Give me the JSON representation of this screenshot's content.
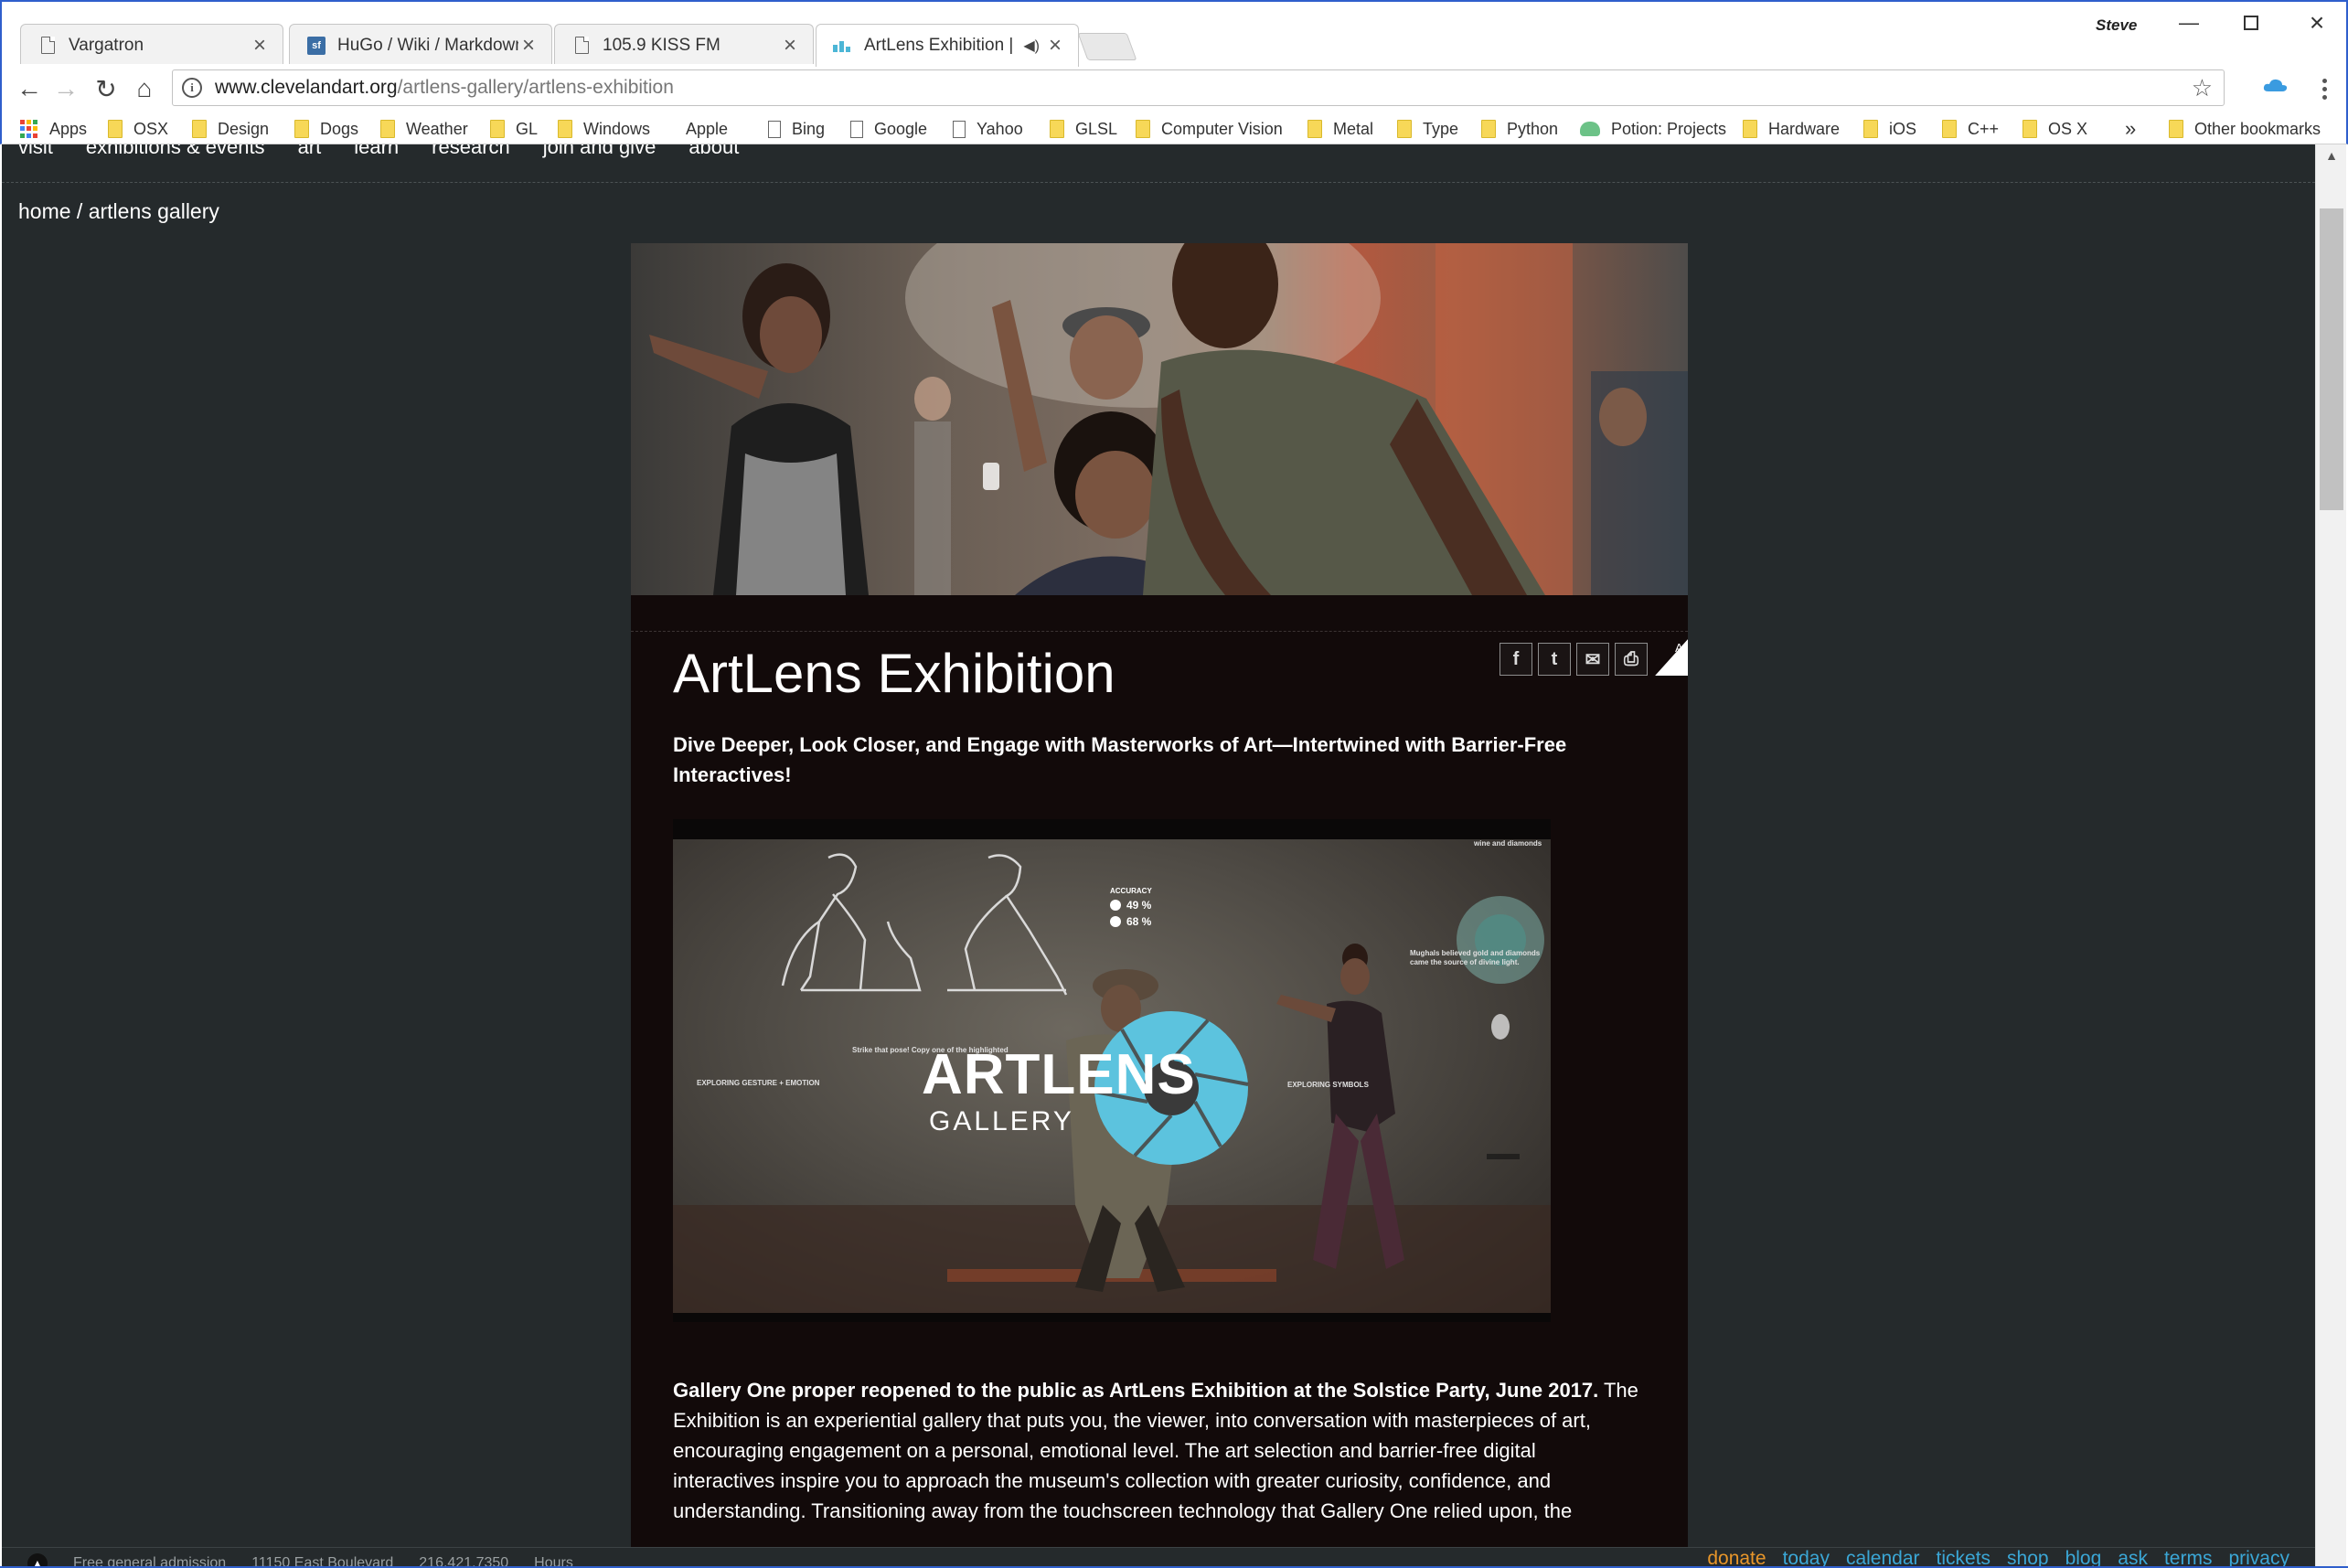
{
  "browser": {
    "tabs": [
      {
        "title": "Vargatron",
        "icon": "document-icon",
        "active": false
      },
      {
        "title": "HuGo / Wiki / Markdown",
        "icon": "sourceforge-icon",
        "active": false
      },
      {
        "title": "105.9 KISS FM",
        "icon": "document-icon",
        "active": false
      },
      {
        "title": "ArtLens Exhibition | Cl",
        "icon": "cma-icon",
        "active": true,
        "audio": true
      }
    ],
    "profile_name": "Steve",
    "url_domain": "www.clevelandart.org",
    "url_path": "/artlens-gallery/artlens-exhibition",
    "bookmarks": [
      {
        "label": "Apps",
        "icon": "apps-icon"
      },
      {
        "label": "OSX",
        "icon": "folder-icon"
      },
      {
        "label": "Design",
        "icon": "folder-icon"
      },
      {
        "label": "Dogs",
        "icon": "folder-icon"
      },
      {
        "label": "Weather",
        "icon": "folder-icon"
      },
      {
        "label": "GL",
        "icon": "folder-icon"
      },
      {
        "label": "Windows",
        "icon": "folder-icon"
      },
      {
        "label": "Apple",
        "icon": "apple-icon"
      },
      {
        "label": "Bing",
        "icon": "page-icon"
      },
      {
        "label": "Google",
        "icon": "page-icon"
      },
      {
        "label": "Yahoo",
        "icon": "page-icon"
      },
      {
        "label": "GLSL",
        "icon": "folder-icon"
      },
      {
        "label": "Computer Vision",
        "icon": "folder-icon"
      },
      {
        "label": "Metal",
        "icon": "folder-icon"
      },
      {
        "label": "Type",
        "icon": "folder-icon"
      },
      {
        "label": "Python",
        "icon": "folder-icon"
      },
      {
        "label": "Potion: Projects",
        "icon": "potion-icon"
      },
      {
        "label": "Hardware",
        "icon": "folder-icon"
      },
      {
        "label": "iOS",
        "icon": "folder-icon"
      },
      {
        "label": "C++",
        "icon": "folder-icon"
      },
      {
        "label": "OS X",
        "icon": "folder-icon"
      }
    ],
    "bookmarks_overflow": "»",
    "other_bookmarks": "Other bookmarks"
  },
  "site": {
    "nav": [
      "visit",
      "exhibitions & events",
      "art",
      "learn",
      "research",
      "join and give",
      "about"
    ],
    "breadcrumb": "home / artlens gallery",
    "share_buttons": [
      {
        "name": "facebook-icon",
        "glyph": "f"
      },
      {
        "name": "twitter-icon",
        "glyph": "t"
      },
      {
        "name": "email-icon",
        "glyph": "✉"
      },
      {
        "name": "print-icon",
        "glyph": "⎙"
      }
    ],
    "fontsize_label": "A"
  },
  "article": {
    "title": "ArtLens Exhibition",
    "subtitle": "Dive Deeper, Look Closer, and Engage with Masterworks of Art—Intertwined with Barrier-Free Interactives!",
    "video": {
      "logo_wordmark": "ARTLENS",
      "logo_sub": "GALLERY",
      "accuracy_label": "ACCURACY",
      "accuracy_values": [
        "49 %",
        "68 %"
      ],
      "prompt_text": "Strike that pose! Copy one of the highlighted",
      "left_label": "EXPLORING GESTURE + EMOTION",
      "right_label": "EXPLORING SYMBOLS",
      "corner_label": "wine and diamonds",
      "side_caption": "Mughals believed gold and diamonds came the source of divine light."
    },
    "body_lead": "Gallery One proper reopened to the public as ArtLens Exhibition at the Solstice Party, June 2017.",
    "body_text": "The Exhibition is an experiential gallery that puts you, the viewer, into conversation with masterpieces of art, encouraging engagement on a personal, emotional level. The art selection and barrier-free digital interactives inspire you to approach the museum's collection with greater curiosity, confidence, and understanding. Transitioning away from the touchscreen technology that Gallery One relied upon, the"
  },
  "footer": {
    "left": [
      "Free general admission",
      "11150 East Boulevard",
      "216.421.7350",
      "Hours"
    ],
    "links": [
      "donate",
      "today",
      "calendar",
      "tickets",
      "shop",
      "blog",
      "ask",
      "terms",
      "privacy"
    ]
  },
  "colors": {
    "page_background": "#252a2c",
    "article_background": "#120a0a",
    "link_blue": "#3ba7d6",
    "donate_orange": "#e8962a",
    "artlens_teal": "#5cc3de",
    "window_frame": "#2f5fcc"
  }
}
